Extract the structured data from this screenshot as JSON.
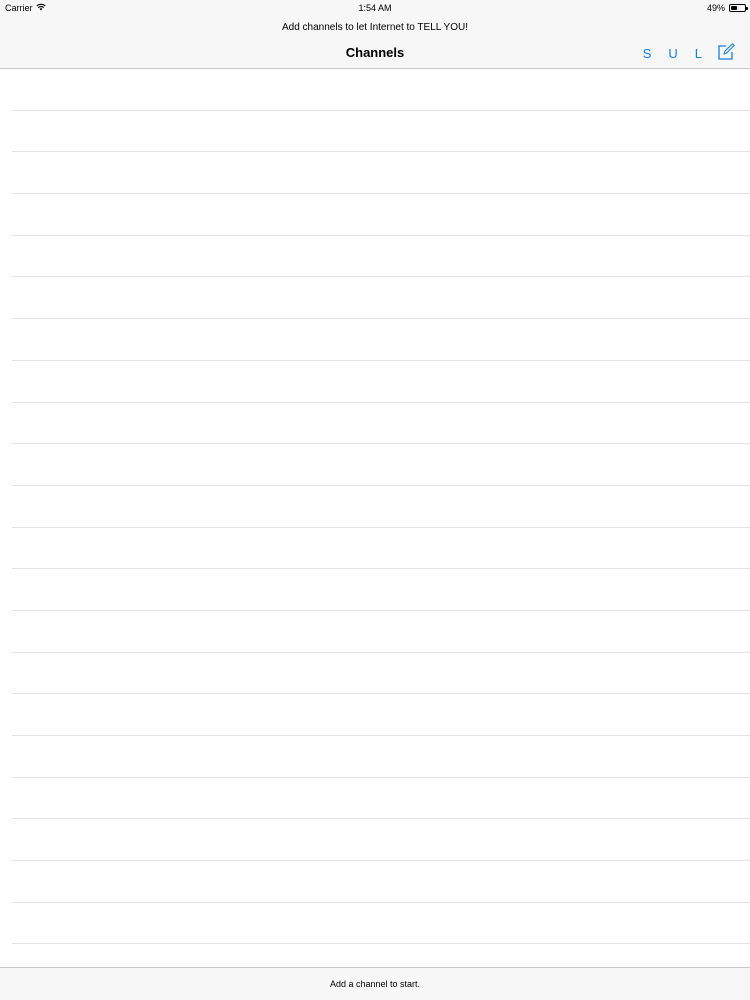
{
  "status_bar": {
    "carrier": "Carrier",
    "time": "1:54 AM",
    "battery_percent": "49%",
    "battery_level": 0.49,
    "wifi_icon": "wifi-icon",
    "battery_icon": "battery-icon"
  },
  "nav": {
    "prompt": "Add channels to let Internet to TELL YOU!",
    "title": "Channels",
    "btn_s": "S",
    "btn_u": "U",
    "btn_l": "L",
    "compose_icon": "compose-icon",
    "accent_color": "#1a7ee0"
  },
  "table": {
    "rows": [
      "",
      "",
      "",
      "",
      "",
      "",
      "",
      "",
      "",
      "",
      "",
      "",
      "",
      "",
      "",
      "",
      "",
      "",
      "",
      "",
      "",
      ""
    ]
  },
  "toolbar": {
    "message": "Add a channel to start."
  }
}
